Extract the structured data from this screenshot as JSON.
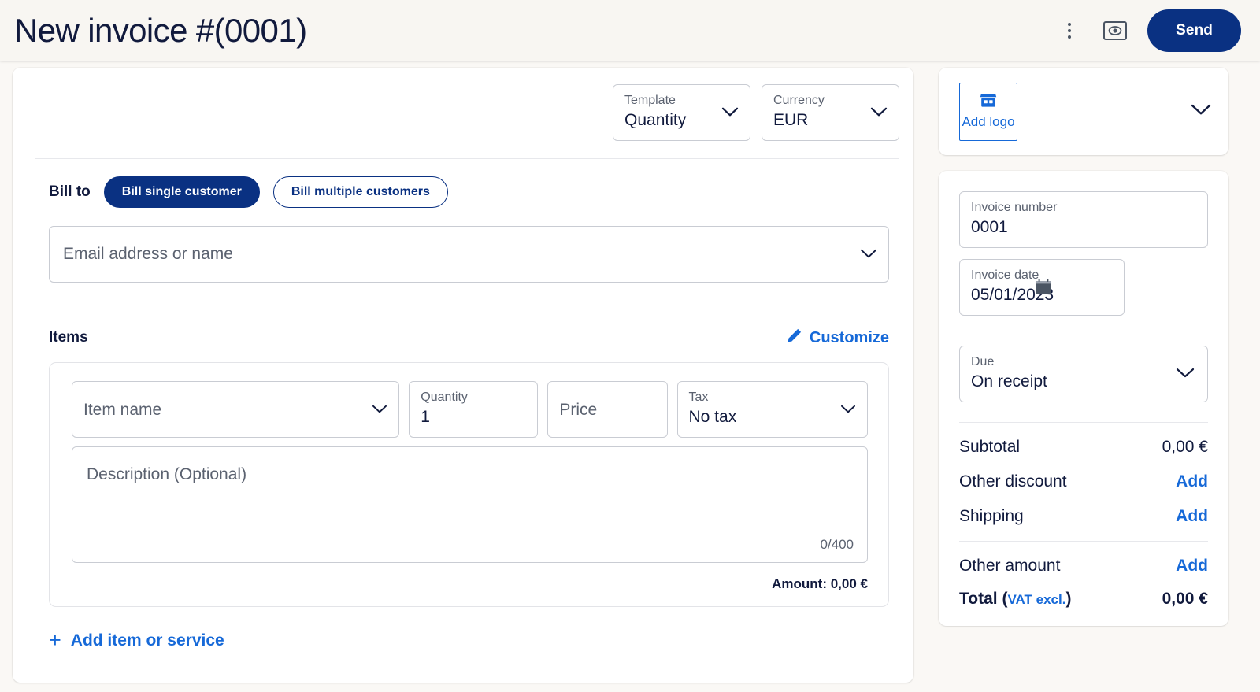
{
  "header": {
    "title": "New invoice #(0001)",
    "send_label": "Send",
    "menu_icon": "kebab-menu-icon",
    "preview_icon": "preview-eye-icon"
  },
  "colors": {
    "brand_dark_blue": "#0a3182",
    "link_blue": "#1669d8",
    "text_navy": "#111a3d",
    "muted": "#5b6270",
    "header_bg": "#f8f6f2",
    "page_bg": "#faf8f5",
    "card_bg": "#ffffff",
    "border": "#c9ccd3"
  },
  "top_selects": {
    "template": {
      "label": "Template",
      "value": "Quantity",
      "icon": "chevron-down-icon"
    },
    "currency": {
      "label": "Currency",
      "value": "EUR",
      "icon": "chevron-down-icon"
    }
  },
  "bill_to": {
    "label": "Bill to",
    "options": [
      {
        "label": "Bill single customer",
        "active": true
      },
      {
        "label": "Bill multiple customers",
        "active": false
      }
    ],
    "customer_input": {
      "placeholder": "Email address or name",
      "value": "",
      "icon": "chevron-down-icon"
    }
  },
  "items": {
    "title": "Items",
    "customize_label": "Customize",
    "customize_icon": "pencil-icon",
    "row": {
      "item_name": {
        "placeholder": "Item name",
        "value": "",
        "icon": "chevron-down-icon"
      },
      "quantity": {
        "label": "Quantity",
        "value": "1"
      },
      "price": {
        "placeholder": "Price",
        "value": ""
      },
      "tax": {
        "label": "Tax",
        "value": "No tax",
        "icon": "chevron-down-icon"
      },
      "description": {
        "placeholder": "Description (Optional)",
        "value": "",
        "counter": "0/400"
      },
      "amount_line": "Amount: 0,00 €"
    },
    "add_item_label": "Add item or service",
    "add_item_icon": "plus-icon"
  },
  "sidebar": {
    "logo": {
      "add_logo_label": "Add logo",
      "logo_icon": "storefront-icon",
      "expand_icon": "chevron-down-icon"
    },
    "invoice_number": {
      "label": "Invoice number",
      "value": "0001"
    },
    "invoice_date": {
      "label": "Invoice date",
      "value": "05/01/2023",
      "icon": "calendar-icon"
    },
    "due": {
      "label": "Due",
      "value": "On receipt",
      "icon": "chevron-down-icon"
    },
    "totals": [
      {
        "label": "Subtotal",
        "value": "0,00 €",
        "action": null
      },
      {
        "label": "Other discount",
        "value": null,
        "action": "Add"
      },
      {
        "label": "Shipping",
        "value": null,
        "action": "Add"
      },
      {
        "label": "Other amount",
        "value": null,
        "action": "Add"
      }
    ],
    "total": {
      "label": "Total",
      "note": "(VAT excl.)",
      "note_inner": "VAT excl.",
      "value": "0,00 €"
    }
  }
}
